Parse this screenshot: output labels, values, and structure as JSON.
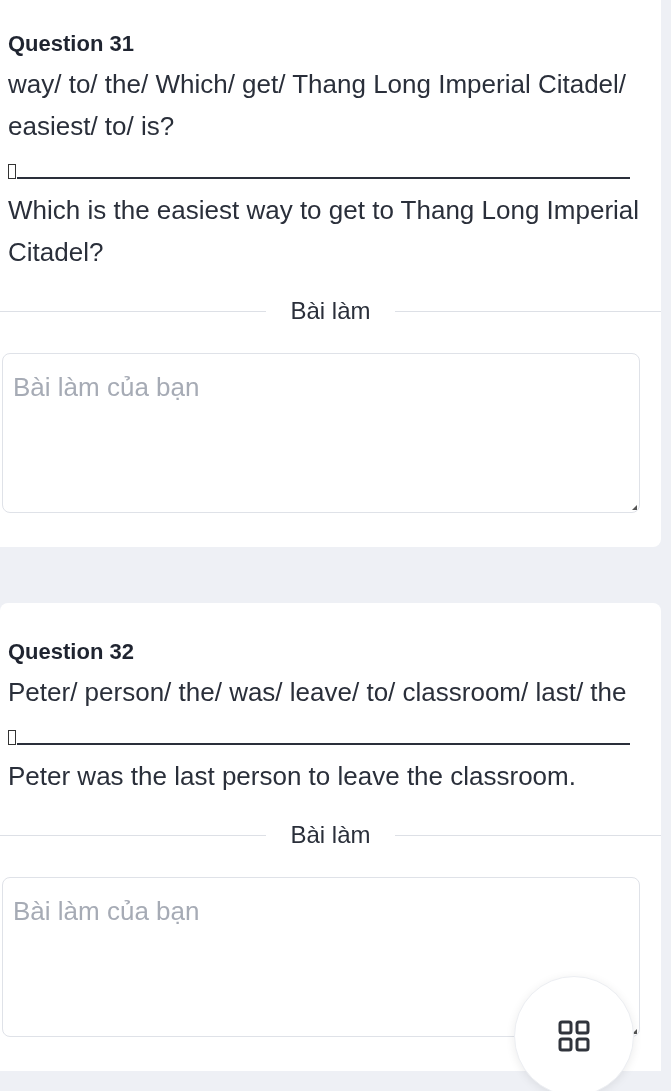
{
  "questions": [
    {
      "title": "Question 31",
      "prompt": "way/ to/ the/ Which/ get/ Thang Long Imperial Citadel/ easiest/ to/ is?",
      "answer": "Which is the easiest way to get to Thang Long Imperial Citadel?",
      "section_label": "Bài làm",
      "answer_box": {
        "placeholder": "Bài làm của bạn"
      }
    },
    {
      "title": "Question 32",
      "prompt": "Peter/ person/ the/ was/ leave/ to/ classroom/ last/ the",
      "answer": "Peter was the last person to leave the classroom.",
      "section_label": "Bài làm",
      "answer_box": {
        "placeholder": "Bài làm của bạn"
      }
    }
  ]
}
